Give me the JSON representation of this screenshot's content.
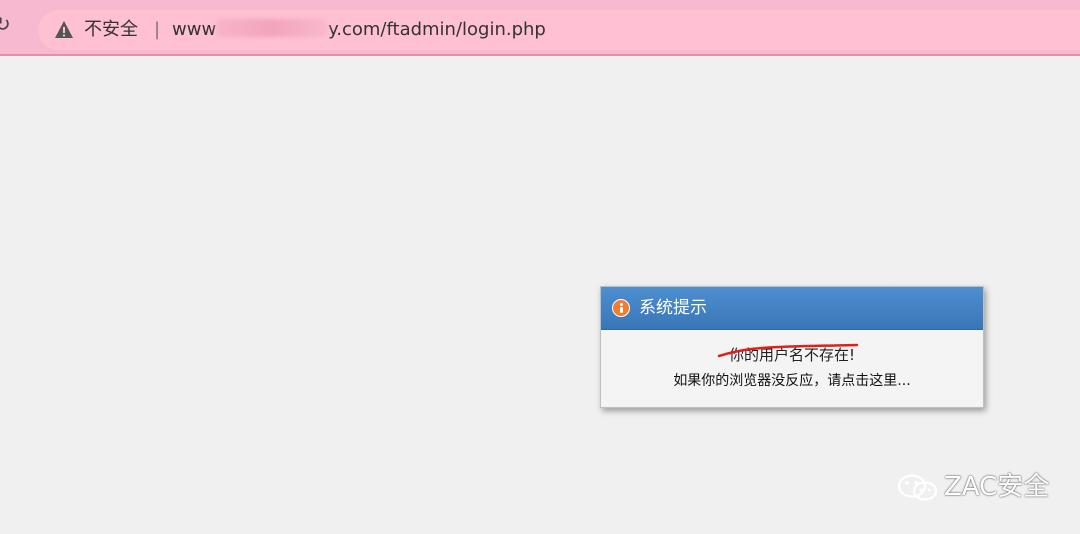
{
  "browser": {
    "security_label": "不安全",
    "separator": "|",
    "url_prefix": "www",
    "url_suffix": "y.com/ftadmin/login.php"
  },
  "dialog": {
    "title": "系统提示",
    "message": "你的用户名不存在!",
    "redirect_text": "如果你的浏览器没反应，请点击这里..."
  },
  "watermark": {
    "text": "ZAC安全"
  },
  "colors": {
    "header_blue": "#3f7fc3",
    "info_orange": "#f27d2f",
    "annotation_red": "#e0201a",
    "address_bar_pink": "#ffc0d3"
  },
  "icons": {
    "reload": "reload-icon",
    "warning": "warning-icon",
    "info": "info-icon",
    "wechat": "wechat-icon"
  }
}
